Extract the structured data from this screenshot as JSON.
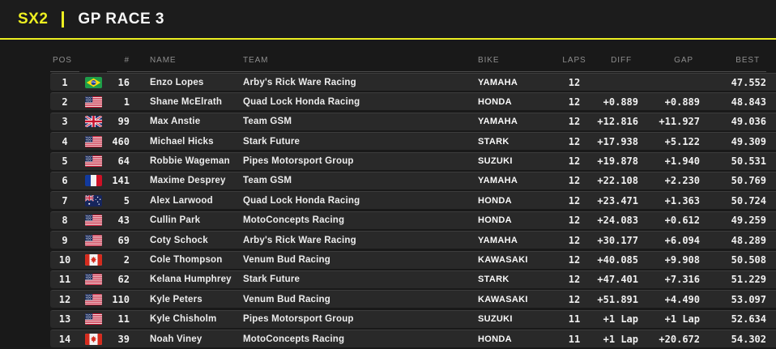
{
  "header": {
    "series": "SX2",
    "divider": "|",
    "race": "GP RACE 3"
  },
  "colors": {
    "accent": "#EDEF21",
    "row_bg": "#292929",
    "page_bg": "#191919"
  },
  "table": {
    "columns": [
      {
        "key": "pos",
        "label": "POS"
      },
      {
        "key": "flag",
        "label": ""
      },
      {
        "key": "num",
        "label": "#"
      },
      {
        "key": "name",
        "label": "NAME"
      },
      {
        "key": "team",
        "label": "TEAM"
      },
      {
        "key": "bike",
        "label": "BIKE"
      },
      {
        "key": "laps",
        "label": "LAPS"
      },
      {
        "key": "diff",
        "label": "DIFF"
      },
      {
        "key": "gap",
        "label": "GAP"
      },
      {
        "key": "best",
        "label": "BEST"
      }
    ],
    "rows": [
      {
        "pos": "1",
        "country": "brazil",
        "num": "16",
        "name": "Enzo Lopes",
        "team": "Arby's Rick Ware Racing",
        "bike": "YAMAHA",
        "laps": "12",
        "diff": "",
        "gap": "",
        "best": "47.552"
      },
      {
        "pos": "2",
        "country": "usa",
        "num": "1",
        "name": "Shane McElrath",
        "team": "Quad Lock Honda Racing",
        "bike": "HONDA",
        "laps": "12",
        "diff": "+0.889",
        "gap": "+0.889",
        "best": "48.843"
      },
      {
        "pos": "3",
        "country": "uk",
        "num": "99",
        "name": "Max Anstie",
        "team": "Team GSM",
        "bike": "YAMAHA",
        "laps": "12",
        "diff": "+12.816",
        "gap": "+11.927",
        "best": "49.036"
      },
      {
        "pos": "4",
        "country": "usa",
        "num": "460",
        "name": "Michael Hicks",
        "team": "Stark Future",
        "bike": "STARK",
        "laps": "12",
        "diff": "+17.938",
        "gap": "+5.122",
        "best": "49.309"
      },
      {
        "pos": "5",
        "country": "usa",
        "num": "64",
        "name": "Robbie Wageman",
        "team": "Pipes Motorsport Group",
        "bike": "SUZUKI",
        "laps": "12",
        "diff": "+19.878",
        "gap": "+1.940",
        "best": "50.531"
      },
      {
        "pos": "6",
        "country": "france",
        "num": "141",
        "name": "Maxime Desprey",
        "team": "Team GSM",
        "bike": "YAMAHA",
        "laps": "12",
        "diff": "+22.108",
        "gap": "+2.230",
        "best": "50.769"
      },
      {
        "pos": "7",
        "country": "australia",
        "num": "5",
        "name": "Alex Larwood",
        "team": "Quad Lock Honda Racing",
        "bike": "HONDA",
        "laps": "12",
        "diff": "+23.471",
        "gap": "+1.363",
        "best": "50.724"
      },
      {
        "pos": "8",
        "country": "usa",
        "num": "43",
        "name": "Cullin Park",
        "team": "MotoConcepts Racing",
        "bike": "HONDA",
        "laps": "12",
        "diff": "+24.083",
        "gap": "+0.612",
        "best": "49.259"
      },
      {
        "pos": "9",
        "country": "usa",
        "num": "69",
        "name": "Coty Schock",
        "team": "Arby's Rick Ware Racing",
        "bike": "YAMAHA",
        "laps": "12",
        "diff": "+30.177",
        "gap": "+6.094",
        "best": "48.289"
      },
      {
        "pos": "10",
        "country": "canada",
        "num": "2",
        "name": "Cole Thompson",
        "team": "Venum Bud Racing",
        "bike": "KAWASAKI",
        "laps": "12",
        "diff": "+40.085",
        "gap": "+9.908",
        "best": "50.508"
      },
      {
        "pos": "11",
        "country": "usa",
        "num": "62",
        "name": "Kelana Humphrey",
        "team": "Stark Future",
        "bike": "STARK",
        "laps": "12",
        "diff": "+47.401",
        "gap": "+7.316",
        "best": "51.229"
      },
      {
        "pos": "12",
        "country": "usa",
        "num": "110",
        "name": "Kyle Peters",
        "team": "Venum Bud Racing",
        "bike": "KAWASAKI",
        "laps": "12",
        "diff": "+51.891",
        "gap": "+4.490",
        "best": "53.097"
      },
      {
        "pos": "13",
        "country": "usa",
        "num": "11",
        "name": "Kyle Chisholm",
        "team": "Pipes Motorsport Group",
        "bike": "SUZUKI",
        "laps": "11",
        "diff": "+1 Lap",
        "gap": "+1 Lap",
        "best": "52.634"
      },
      {
        "pos": "14",
        "country": "canada",
        "num": "39",
        "name": "Noah Viney",
        "team": "MotoConcepts Racing",
        "bike": "HONDA",
        "laps": "11",
        "diff": "+1 Lap",
        "gap": "+20.672",
        "best": "54.302"
      }
    ]
  }
}
